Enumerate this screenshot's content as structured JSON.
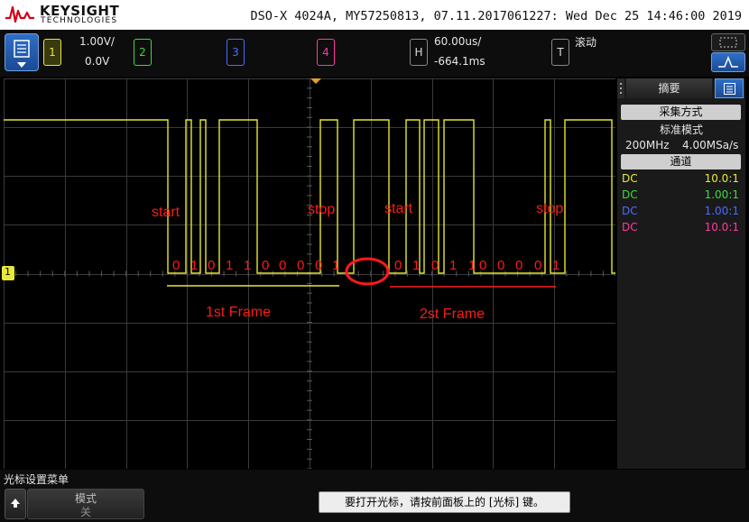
{
  "header": {
    "brand": "KEYSIGHT",
    "brand_sub": "TECHNOLOGIES",
    "model_line": "DSO-X 4024A, MY57250813, 07.11.2017061227: Wed Dec 25 14:46:00 2019"
  },
  "controls": {
    "channel1": {
      "label": "1",
      "scale": "1.00V/",
      "offset": "0.0V",
      "color": "#e8e83a"
    },
    "channel2": {
      "label": "2",
      "color": "#3ddc3d"
    },
    "channel3": {
      "label": "3",
      "color": "#4a6cff"
    },
    "channel4": {
      "label": "4",
      "color": "#ff3aa0"
    },
    "horizontal": {
      "label": "H",
      "timebase": "60.00us/",
      "delay": "-664.1ms"
    },
    "trigger": {
      "label": "T",
      "mode": "滚动"
    }
  },
  "side_panel": {
    "tab_label": "摘要",
    "acq_header": "采集方式",
    "acq_mode": "标准模式",
    "bandwidth": "200MHz",
    "sample_rate": "4.00MSa/s",
    "channels_header": "通道",
    "channels": [
      {
        "coupling": "DC",
        "ratio": "10.0:1",
        "color": "#e8e83a"
      },
      {
        "coupling": "DC",
        "ratio": "1.00:1",
        "color": "#3ddc3d"
      },
      {
        "coupling": "DC",
        "ratio": "1.00:1",
        "color": "#4a6cff"
      },
      {
        "coupling": "DC",
        "ratio": "10.0:1",
        "color": "#ff3aa0"
      }
    ]
  },
  "annotations": {
    "start1": "start",
    "stop1": "stop",
    "start2": "start",
    "stop2": "stop",
    "frame1": "1st Frame",
    "frame2": "2st Frame",
    "bits1": [
      "0",
      "1",
      "0",
      "1",
      "1",
      "0",
      "0",
      "0",
      "0",
      "1"
    ],
    "bits2": [
      "0",
      "1",
      "0",
      "1",
      "1",
      "0",
      "0",
      "0",
      "0",
      "1"
    ],
    "ground_marker": "1"
  },
  "bottom": {
    "menu_title": "光标设置菜单",
    "mode_label": "模式",
    "mode_value": "关",
    "hint": "要打开光标，请按前面板上的 [光标] 键。"
  }
}
